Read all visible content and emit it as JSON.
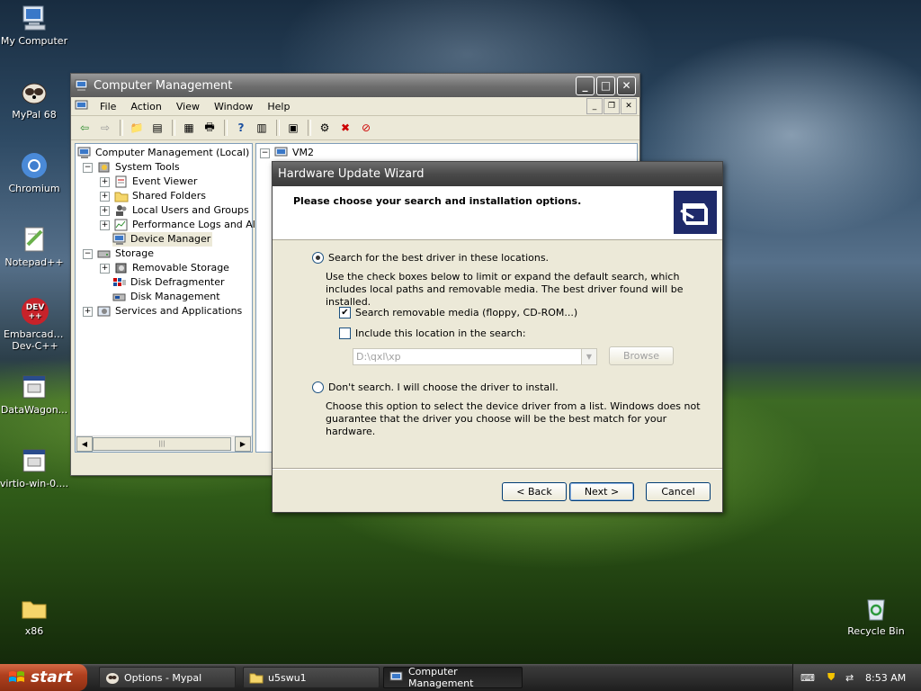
{
  "desktop": {
    "icons": [
      {
        "label": "My Computer"
      },
      {
        "label": "MyPal 68"
      },
      {
        "label": "Chromium"
      },
      {
        "label": "Notepad++"
      },
      {
        "label": "Embarcadero Dev-C++"
      },
      {
        "label": "DataWagon..."
      },
      {
        "label": "virtio-win-0...."
      },
      {
        "label": "x86"
      },
      {
        "label": "Recycle Bin"
      }
    ]
  },
  "cm_window": {
    "title": "Computer Management",
    "menu": [
      "File",
      "Action",
      "View",
      "Window",
      "Help"
    ],
    "tree": [
      {
        "label": "Computer Management (Local)"
      },
      {
        "label": "System Tools"
      },
      {
        "label": "Event Viewer"
      },
      {
        "label": "Shared Folders"
      },
      {
        "label": "Local Users and Groups"
      },
      {
        "label": "Performance Logs and Alerts"
      },
      {
        "label": "Device Manager"
      },
      {
        "label": "Storage"
      },
      {
        "label": "Removable Storage"
      },
      {
        "label": "Disk Defragmenter"
      },
      {
        "label": "Disk Management"
      },
      {
        "label": "Services and Applications"
      }
    ],
    "right_pane_root": "VM2"
  },
  "wizard": {
    "title": "Hardware Update Wizard",
    "header": "Please choose your search and installation options.",
    "option_search": "Search for the best driver in these locations.",
    "option_search_desc": "Use the check boxes below to limit or expand the default search, which includes local paths and removable media. The best driver found will be installed.",
    "check_removable": "Search removable media (floppy, CD-ROM...)",
    "check_removable_checked": true,
    "check_location": "Include this location in the search:",
    "check_location_checked": false,
    "location_value": "D:\\qxl\\xp",
    "browse_label": "Browse",
    "option_dont_search": "Don't search. I will choose the driver to install.",
    "option_dont_search_desc": "Choose this option to select the device driver from a list.  Windows does not guarantee that the driver you choose will be the best match for your hardware.",
    "back_label": "< Back",
    "next_label": "Next >",
    "cancel_label": "Cancel"
  },
  "taskbar": {
    "start_label": "start",
    "tasks": [
      {
        "label": "Options - Mypal"
      },
      {
        "label": "u5swu1"
      },
      {
        "label": "Computer Management"
      }
    ],
    "clock": "8:53 AM"
  }
}
